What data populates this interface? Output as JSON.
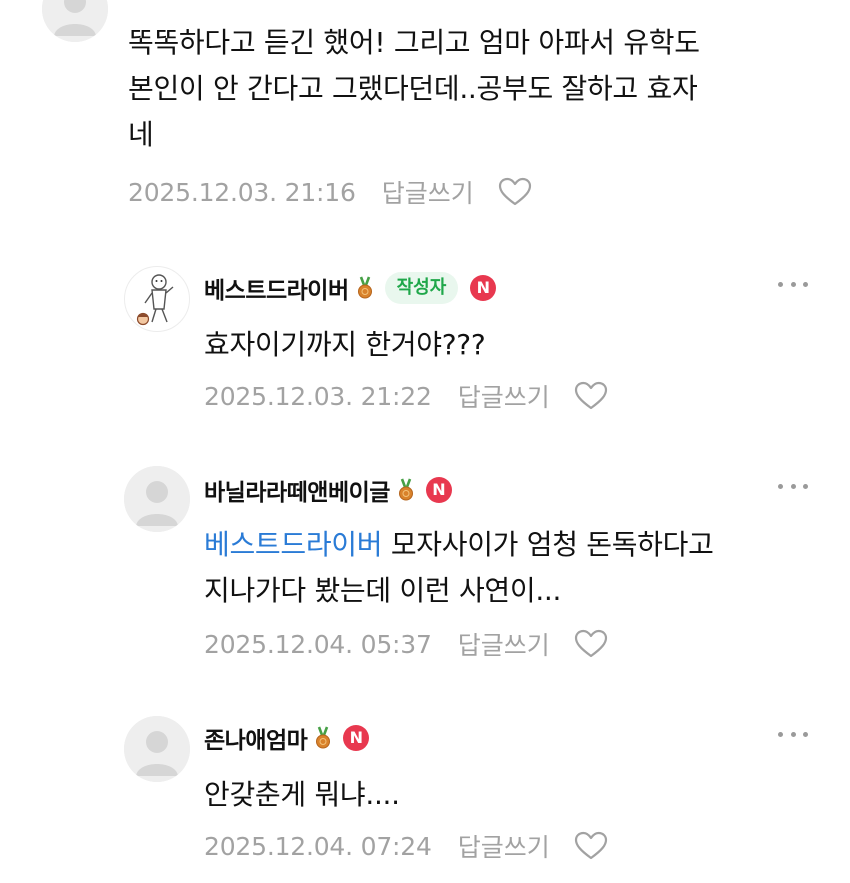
{
  "comments": [
    {
      "nickname": "",
      "body_lines": [
        "똑똑하다고 듣긴 했어! 그리고 엄마 아파서 유학도",
        "본인이 안 간다고 그랬다던데..공부도 잘하고 효자",
        "네"
      ],
      "date": "2025.12.03. 21:16",
      "reply_label": "답글쓰기"
    },
    {
      "nickname": "베스트드라이버",
      "author_badge": "작성자",
      "n_badge": "N",
      "body_lines": [
        "효자이기까지 한거야???"
      ],
      "date": "2025.12.03. 21:22",
      "reply_label": "답글쓰기"
    },
    {
      "nickname": "바닐라라떼앤베이글",
      "n_badge": "N",
      "mention": "베스트드라이버",
      "body_first_rest": " 모자사이가 엄청 돈독하다고",
      "body_second": "지나가다 봤는데 이런 사연이...",
      "date": "2025.12.04. 05:37",
      "reply_label": "답글쓰기"
    },
    {
      "nickname": "존나애엄마",
      "n_badge": "N",
      "body_lines": [
        "안갖춘게 뭐냐...."
      ],
      "date": "2025.12.04. 07:24",
      "reply_label": "답글쓰기"
    }
  ],
  "colors": {
    "meta_gray": "#a2a2a2",
    "mention_blue": "#2a7bd6",
    "author_badge_green": "#1fa74a",
    "n_badge_red": "#e8384f"
  },
  "icons": [
    "more-icon",
    "medal-icon",
    "heart-icon",
    "default-avatar-icon"
  ]
}
